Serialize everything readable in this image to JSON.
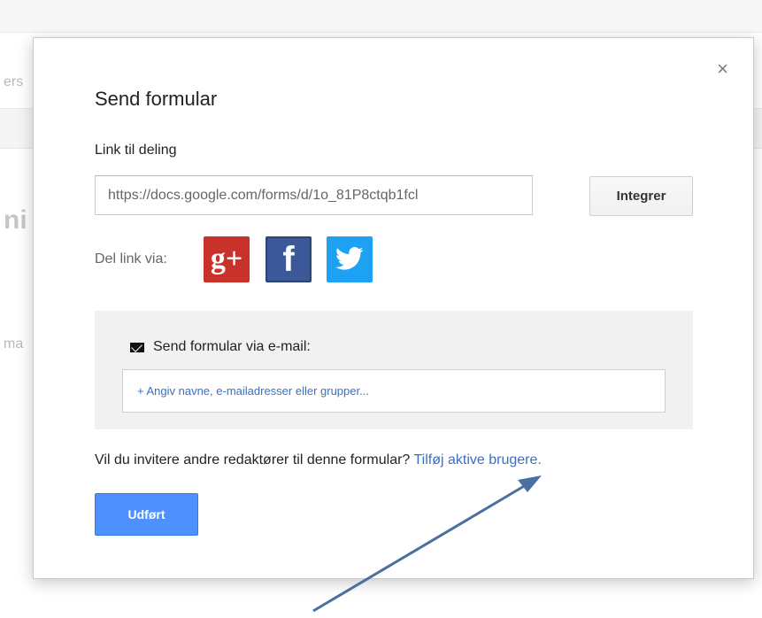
{
  "background": {
    "fragments": [
      "ers",
      "ni",
      "ma"
    ]
  },
  "dialog": {
    "title": "Send formular",
    "close_glyph": "×",
    "share_link_label": "Link til deling",
    "share_link_value": "https://docs.google.com/forms/d/1o_81P8ctqb1fcl",
    "embed_button": "Integrer",
    "share_via_label": "Del link via:",
    "social": [
      {
        "name": "google-plus",
        "glyph": "g+"
      },
      {
        "name": "facebook",
        "glyph": "f"
      },
      {
        "name": "twitter",
        "glyph": "twitter-bird-icon"
      }
    ],
    "email_title": "Send formular via e-mail:",
    "email_placeholder": "+ Angiv navne, e-mailadresser eller grupper...",
    "invite_text": "Vil du invitere andre redaktører til denne formular?",
    "invite_link": "Tilføj aktive brugere.",
    "done_button": "Udført"
  },
  "colors": {
    "primary_button": "#4d90fe",
    "link": "#3b6fc6",
    "arrow": "#4a6fa1"
  }
}
